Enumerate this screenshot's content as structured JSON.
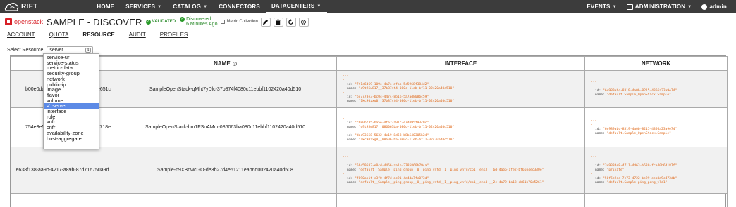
{
  "topbar": {
    "brand": "RIFT",
    "nav": [
      {
        "label": "HOME",
        "caret": false,
        "active": false
      },
      {
        "label": "SERVICES",
        "caret": true,
        "active": false
      },
      {
        "label": "CATALOG",
        "caret": true,
        "active": false
      },
      {
        "label": "CONNECTORS",
        "caret": false,
        "active": false
      },
      {
        "label": "DATACENTERS",
        "caret": true,
        "active": true
      }
    ],
    "right": {
      "events": "EVENTS",
      "administration": "ADMINISTRATION",
      "user": "admin"
    }
  },
  "header": {
    "openstack_logo_text": "openstack",
    "title": "SAMPLE - DISCOVER",
    "validated": "VALIDATED",
    "discovered_line1": "Discovered",
    "discovered_line2": "6 Minutes Ago",
    "metric_collection": "Metric Collection",
    "status_color": "#2a8a2a",
    "tools": [
      "pencil-icon",
      "trash-icon",
      "refresh-icon",
      "settings-icon"
    ]
  },
  "subtabs": [
    "ACCOUNT",
    "QUOTA",
    "RESOURCE",
    "AUDIT",
    "PROFILES"
  ],
  "active_subtab": "RESOURCE",
  "select": {
    "label": "Select Resource:",
    "value": "server",
    "options": [
      "service-uri",
      "service-status",
      "metric-data",
      "security-group",
      "network",
      "public-ip",
      "image",
      "flavor",
      "volume",
      "server",
      "interface",
      "role",
      "vnfr",
      "cnfr",
      "availability-zone",
      "host-aggregate"
    ],
    "selected_marker": "✓"
  },
  "table": {
    "headers": [
      "",
      "NAME",
      "INTERFACE",
      "NETWORK"
    ],
    "rows": [
      {
        "id_left": "b00e0dd6",
        "id_right": "6e651c",
        "name": "SampleOpenStack-qMht7yDlc-37b874f4080c11ebbf1102420a40d510",
        "interface": [
          {
            "id": "\"7f1e6d69-109e-4a7e-afab-5c5968f384d2\"",
            "name": "\"c9t95w817__37b874f4-080c-11eb-bf11-02420a40d510\""
          },
          {
            "id": "\"bc7773e3-bc04-4474-8b1b-5a7ad808bc59\"",
            "name": "\"1kc90zxg0__37b874f4-080c-11eb-bf11-02420a40d510\""
          }
        ],
        "network": [
          {
            "id": "\"6c989abc-8319-4a0b-8215-4356a23a9e74\"",
            "name": "\"default.Sample_OpenStack.Sample\""
          }
        ]
      },
      {
        "id_left": "754e3e5b",
        "id_right": "38718e",
        "name": "SampleOpenStack-bm1FSnAMm-086063ba080c11ebbf1102420a40d510",
        "interface": [
          {
            "id": "\"c680bf35-ba5e-4fa2-a91c-e74095f93c0c\"",
            "name": "\"c9t95w817__086063ba-080c-11eb-bf11-02420a40d510\""
          },
          {
            "id": "\"dac93558-5632-4c19-8d58-b8b540305b24\"",
            "name": "\"1kc90zxg0__086063ba-080c-11eb-bf11-02420a40d510\""
          }
        ],
        "network": [
          {
            "id": "\"6c989abc-8319-4a0b-8215-4356a23a9e74\"",
            "name": "\"default.Sample_OpenStack.Sample\""
          }
        ]
      },
      {
        "id_full": "e638f138-aa9b-4217-a89b-87d716750a9d",
        "name": "Sample-n9XBnwcGO-de3b27d4e61211eab6d002420a40d508",
        "interface": [
          {
            "id": "\"56c59583-e0cd-4456-aa1b-2785860b794a\"",
            "name": "\"default__Sample__ping_group__0__ping_vnfd__1__ping_vnfd/cp1__ens3 __6d-4ab6-afe2-bf66b4ec330e\""
          },
          {
            "id": "\"f890ab1f-e3f0-4f7d-ac91-4a4da7fc073d\"",
            "name": "\"default__Sample__ping_group__0__ping_vnfd__1__ping_vnfd/cp1__ens4 __2c-4a79-ba18-cb61b70e5261\""
          }
        ],
        "network": [
          {
            "id": "\"3c938de8-4711-4d63-b530-fca40b6d187f\"",
            "name": "\"private\""
          },
          {
            "id": "\"50f5c2de-7c73-4722-be99-eea0a9c473db\"",
            "name": "\"default.Sample.ping_pong_vld1\""
          }
        ]
      }
    ]
  },
  "colors": {
    "topbar_bg": "#3c3c3c",
    "openstack_red": "#d71f26",
    "yaml_value": "#e06a1b",
    "dropdown_selected": "#5c8ae6"
  }
}
